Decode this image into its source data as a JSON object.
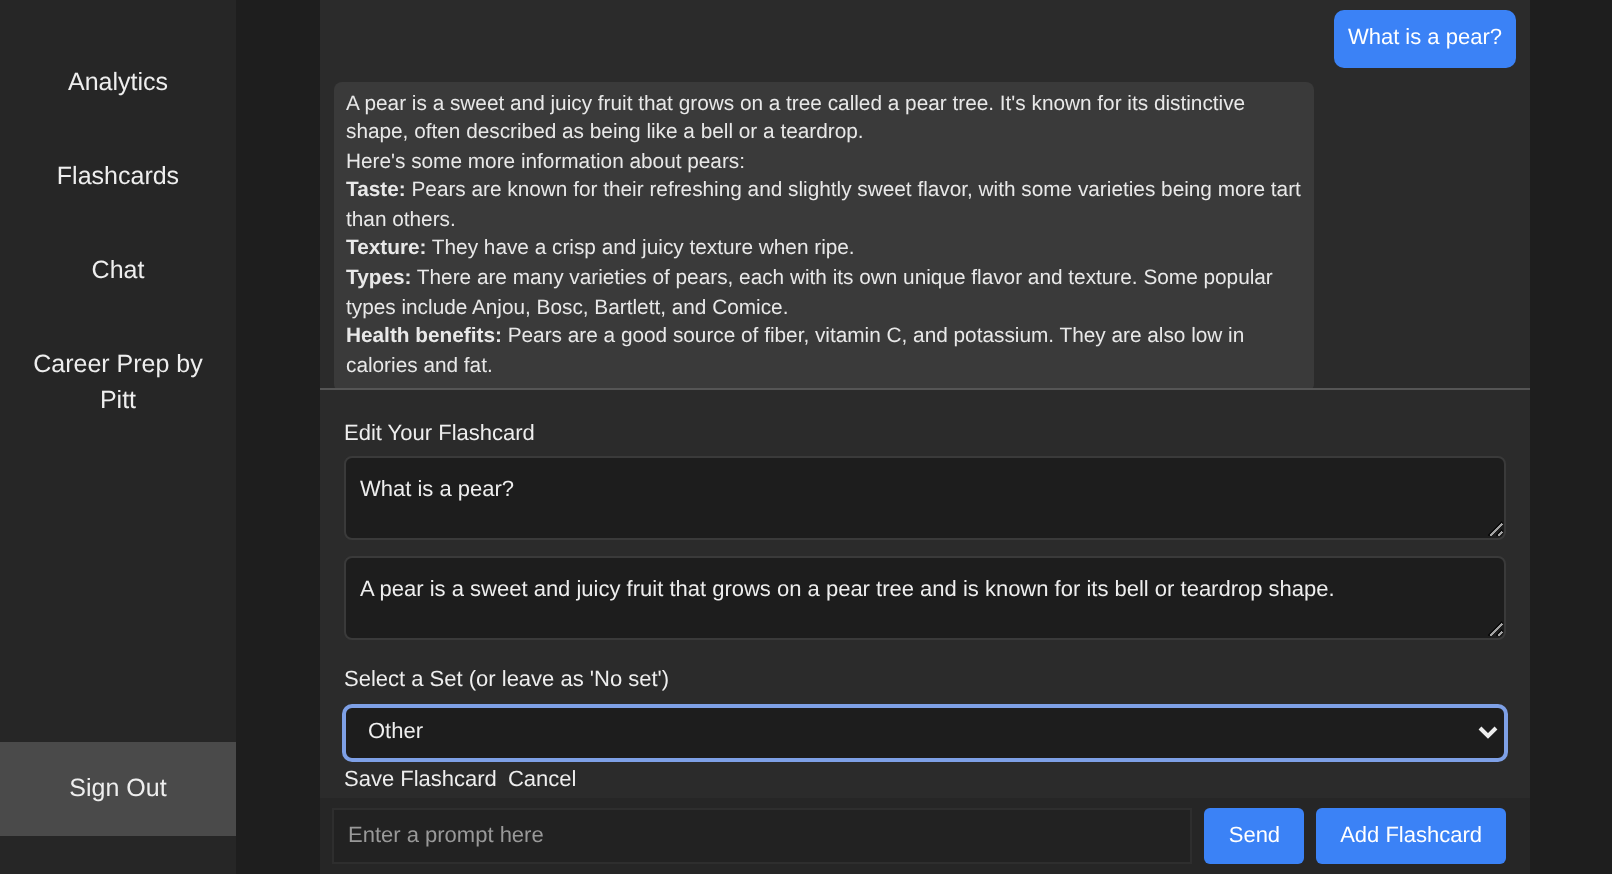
{
  "sidebar": {
    "items": [
      {
        "label": "Analytics"
      },
      {
        "label": "Flashcards"
      },
      {
        "label": "Chat"
      },
      {
        "label": "Career Prep by Pitt"
      }
    ],
    "sign_out": "Sign Out"
  },
  "messages": [
    {
      "kind": "user",
      "paragraphs": [
        "What is a pear?"
      ]
    },
    {
      "kind": "assistant",
      "paragraphs": [
        "A pear is a sweet and juicy fruit that grows on a tree called a pear tree. It's known for its distinctive shape, often described as being like a bell or a teardrop.",
        "Here's some more information about pears:",
        "**Taste:** Pears are known for their refreshing and slightly sweet flavor, with some varieties being more tart than others.",
        "**Texture:** They have a crisp and juicy texture when ripe.",
        "**Types:** There are many varieties of pears, each with its own unique flavor and texture. Some popular types include Anjou, Bosc, Bartlett, and Comice.",
        "**Health benefits:** Pears are a good source of fiber, vitamin C, and potassium. They are also low in calories and fat."
      ]
    }
  ],
  "editor": {
    "title": "Edit Your Flashcard",
    "question": "What is a pear?",
    "answer": "A pear is a sweet and juicy fruit that grows on a pear tree and is known for its bell or teardrop shape.",
    "set_label": "Select a Set (or leave as 'No set')",
    "set_value": "Other",
    "actions": [
      "Save Flashcard",
      "Cancel"
    ]
  },
  "prompt": {
    "placeholder": "Enter a prompt here"
  },
  "buttons": [
    "Send",
    "Add Flashcard"
  ]
}
